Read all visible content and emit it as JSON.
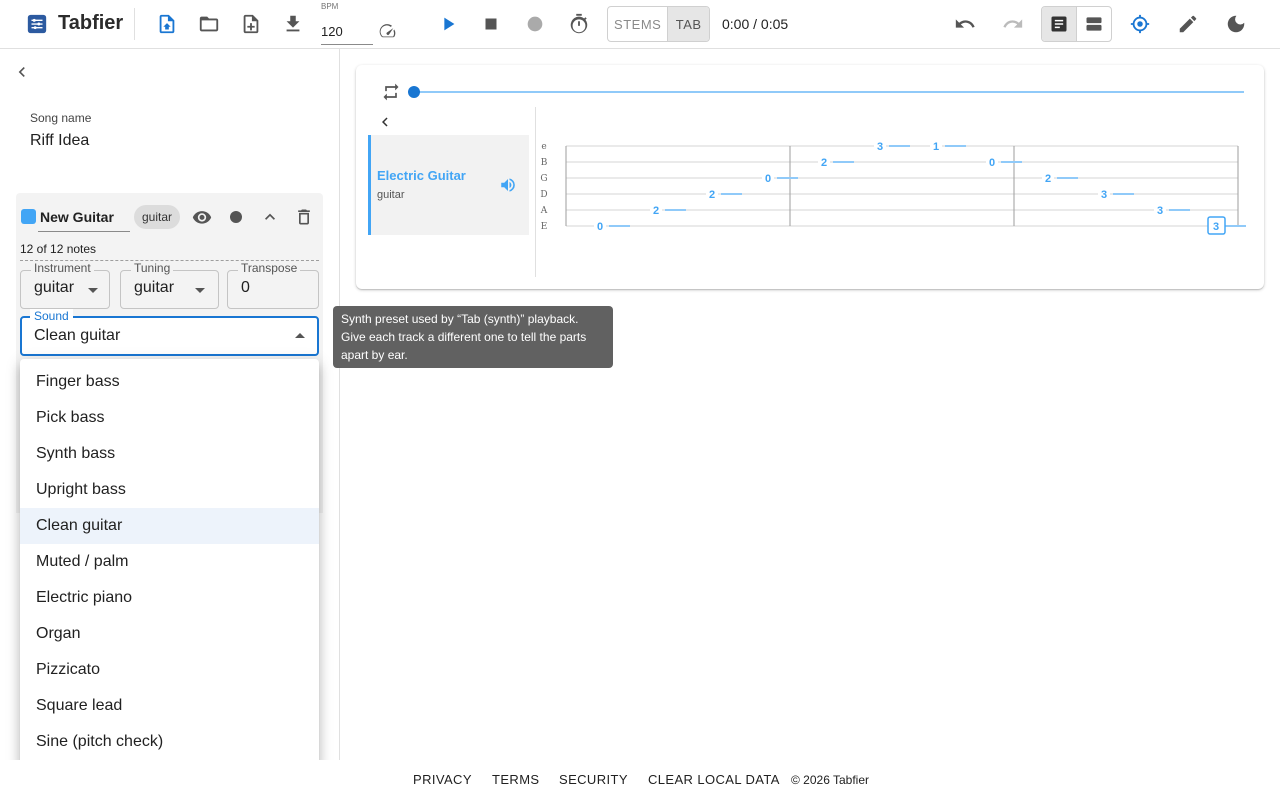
{
  "app": {
    "name": "Tabfier"
  },
  "toolbar": {
    "bpm_label": "BPM",
    "bpm_value": "120",
    "mode_options": [
      "STEMS",
      "TAB"
    ],
    "mode_selected": "TAB",
    "time_display": "0:00 / 0:05"
  },
  "song": {
    "label": "Song name",
    "name": "Riff Idea"
  },
  "track": {
    "name": "New Guitar",
    "type_chip": "guitar",
    "notes_count": "12 of 12 notes",
    "color": "#42a5f5",
    "instrument": {
      "label": "Instrument",
      "value": "guitar"
    },
    "tuning": {
      "label": "Tuning",
      "value": "guitar"
    },
    "transpose": {
      "label": "Transpose",
      "value": "0"
    },
    "sound": {
      "label": "Sound",
      "value": "Clean guitar"
    }
  },
  "sound_menu": {
    "options": [
      "Finger bass",
      "Pick bass",
      "Synth bass",
      "Upright bass",
      "Clean guitar",
      "Muted / palm",
      "Electric piano",
      "Organ",
      "Pizzicato",
      "Square lead",
      "Sine (pitch check)"
    ],
    "selected": "Clean guitar"
  },
  "tooltip": {
    "text": "Synth preset used by “Tab (synth)” playback. Give each track a different one to tell the parts apart by ear."
  },
  "score": {
    "track_name": "Electric Guitar",
    "track_sub": "guitar",
    "strings": [
      "e",
      "B",
      "G",
      "D",
      "A",
      "E"
    ],
    "notes": [
      {
        "string": "E",
        "fret": "0"
      },
      {
        "string": "A",
        "fret": "2"
      },
      {
        "string": "D",
        "fret": "2"
      },
      {
        "string": "G",
        "fret": "0"
      },
      {
        "string": "B",
        "fret": "2"
      },
      {
        "string": "e",
        "fret": "3"
      },
      {
        "string": "e",
        "fret": "1"
      },
      {
        "string": "B",
        "fret": "0"
      },
      {
        "string": "G",
        "fret": "2"
      },
      {
        "string": "D",
        "fret": "3"
      },
      {
        "string": "A",
        "fret": "3"
      },
      {
        "string": "E",
        "fret": "3",
        "selected": true
      }
    ]
  },
  "footer": {
    "links": [
      "PRIVACY",
      "TERMS",
      "SECURITY",
      "CLEAR LOCAL DATA"
    ],
    "copyright": "© 2026 Tabfier"
  },
  "colors": {
    "primary": "#1976d2",
    "accent": "#42a5f5",
    "tooltip_bg": "#616161"
  }
}
